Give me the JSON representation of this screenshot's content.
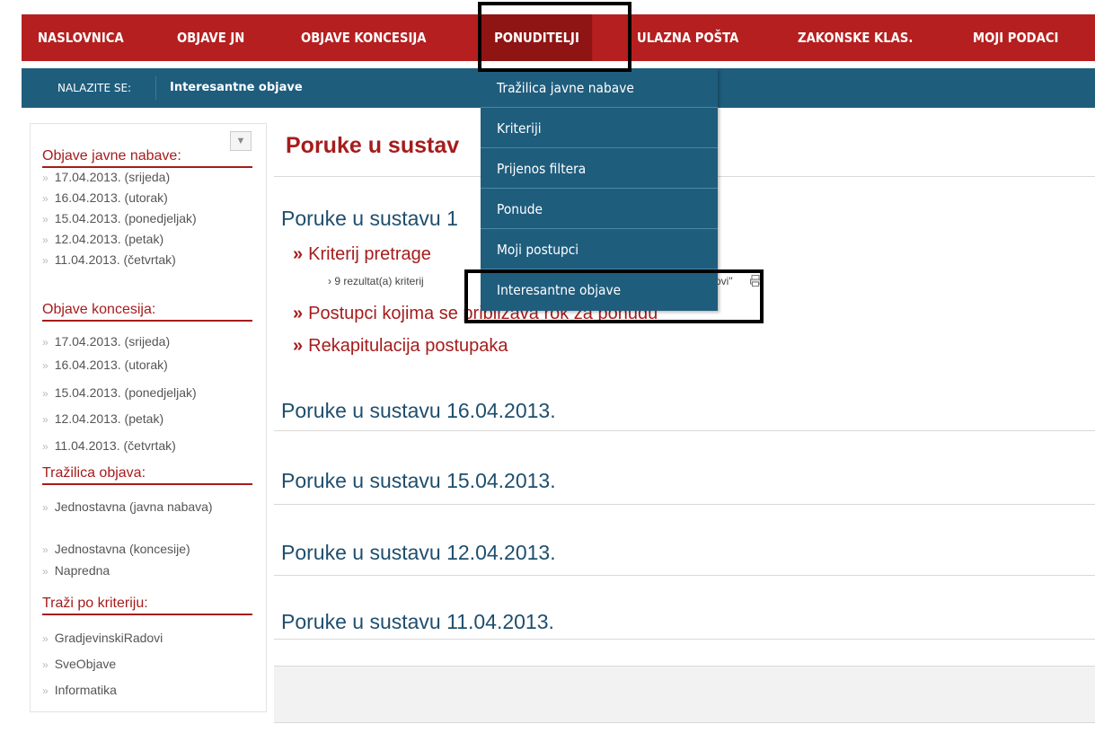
{
  "nav": {
    "items": [
      "NASLOVNICA",
      "OBJAVE JN",
      "OBJAVE KONCESIJA",
      "PONUDITELJI",
      "ULAZNA POŠTA",
      "ZAKONSKE KLAS.",
      "MOJI PODACI"
    ],
    "active": "PONUDITELJI"
  },
  "breadcrumb": {
    "label": "NALAZITE SE:",
    "value": "Interesantne objave"
  },
  "dropdown": {
    "items": [
      "Tražilica javne nabave",
      "Kriteriji",
      "Prijenos filtera",
      "Ponude",
      "Moji postupci",
      "Interesantne objave"
    ],
    "highlighted": "Interesantne objave"
  },
  "sidebar": {
    "sections": [
      {
        "heading": "Objave javne nabave:",
        "items": [
          "17.04.2013. (srijeda)",
          "16.04.2013. (utorak)",
          "15.04.2013. (ponedjeljak)",
          "12.04.2013. (petak)",
          "11.04.2013. (četvrtak)"
        ]
      },
      {
        "heading": "Objave koncesija:",
        "items": [
          "17.04.2013. (srijeda)",
          "16.04.2013. (utorak)",
          "15.04.2013. (ponedjeljak)",
          "12.04.2013. (petak)",
          "11.04.2013. (četvrtak)"
        ]
      },
      {
        "heading": "Tražilica objava:",
        "items": [
          "Jednostavna (javna nabava)",
          "Jednostavna (koncesije)",
          "Napredna"
        ]
      },
      {
        "heading": "Traži po kriteriju:",
        "items": [
          "GradjevinskiRadovi",
          "SveObjave",
          "Informatika"
        ]
      }
    ],
    "chevron": "»",
    "dropdown_icon": "triangle-down-icon"
  },
  "main": {
    "title": "Poruke u sustav",
    "sections": [
      {
        "title": "Poruke u sustavu 1"
      },
      {
        "title": "Poruke u sustavu 16.04.2013."
      },
      {
        "title": "Poruke u sustavu 15.04.2013."
      },
      {
        "title": "Poruke u sustavu 12.04.2013."
      },
      {
        "title": "Poruke u sustavu 11.04.2013."
      }
    ],
    "links": [
      "Kriterij pretrage",
      "Postupci kojima se približava rok za ponudu",
      "Rekapitulacija postupaka"
    ],
    "link_arrow": "»",
    "result_text": "› 9 rezultat(a) kriterij",
    "result_suffix": "ovi\""
  },
  "colors": {
    "red": "#b51f1f",
    "blue": "#1f5d7d",
    "link_red": "#a61c1c",
    "title_blue": "#1f4e6e"
  }
}
